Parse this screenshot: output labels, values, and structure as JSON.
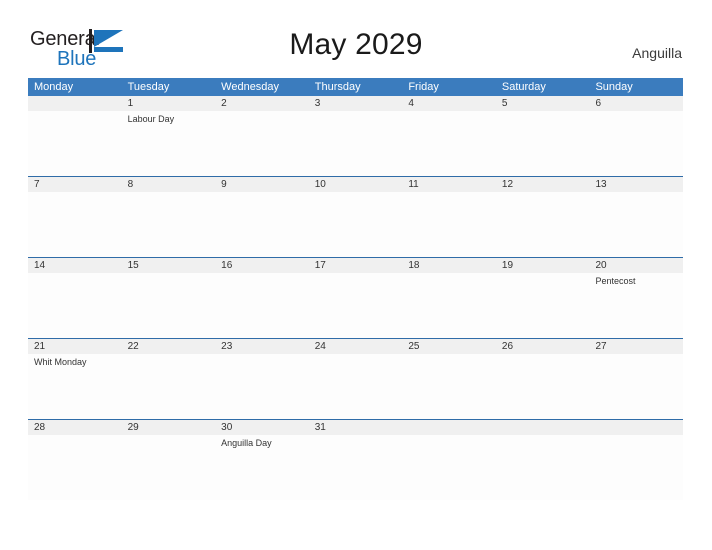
{
  "brand": {
    "name_part1": "General",
    "name_part2": "Blue",
    "flag_icon": "flag-icon",
    "accent_color": "#1e74bb"
  },
  "header": {
    "title": "May 2029",
    "region": "Anguilla"
  },
  "colors": {
    "header_blue": "#3b7cbe",
    "row_divider": "#2f6ca8",
    "date_strip": "#f0f0f0",
    "text": "#333333"
  },
  "calendar": {
    "weekdays": [
      "Monday",
      "Tuesday",
      "Wednesday",
      "Thursday",
      "Friday",
      "Saturday",
      "Sunday"
    ],
    "weeks": [
      {
        "days": [
          {
            "date": "",
            "events": []
          },
          {
            "date": "1",
            "events": [
              "Labour Day"
            ]
          },
          {
            "date": "2",
            "events": []
          },
          {
            "date": "3",
            "events": []
          },
          {
            "date": "4",
            "events": []
          },
          {
            "date": "5",
            "events": []
          },
          {
            "date": "6",
            "events": []
          }
        ]
      },
      {
        "days": [
          {
            "date": "7",
            "events": []
          },
          {
            "date": "8",
            "events": []
          },
          {
            "date": "9",
            "events": []
          },
          {
            "date": "10",
            "events": []
          },
          {
            "date": "11",
            "events": []
          },
          {
            "date": "12",
            "events": []
          },
          {
            "date": "13",
            "events": []
          }
        ]
      },
      {
        "days": [
          {
            "date": "14",
            "events": []
          },
          {
            "date": "15",
            "events": []
          },
          {
            "date": "16",
            "events": []
          },
          {
            "date": "17",
            "events": []
          },
          {
            "date": "18",
            "events": []
          },
          {
            "date": "19",
            "events": []
          },
          {
            "date": "20",
            "events": [
              "Pentecost"
            ]
          }
        ]
      },
      {
        "days": [
          {
            "date": "21",
            "events": [
              "Whit Monday"
            ]
          },
          {
            "date": "22",
            "events": []
          },
          {
            "date": "23",
            "events": []
          },
          {
            "date": "24",
            "events": []
          },
          {
            "date": "25",
            "events": []
          },
          {
            "date": "26",
            "events": []
          },
          {
            "date": "27",
            "events": []
          }
        ]
      },
      {
        "days": [
          {
            "date": "28",
            "events": []
          },
          {
            "date": "29",
            "events": []
          },
          {
            "date": "30",
            "events": [
              "Anguilla Day"
            ]
          },
          {
            "date": "31",
            "events": []
          },
          {
            "date": "",
            "events": []
          },
          {
            "date": "",
            "events": []
          },
          {
            "date": "",
            "events": []
          }
        ]
      }
    ]
  }
}
